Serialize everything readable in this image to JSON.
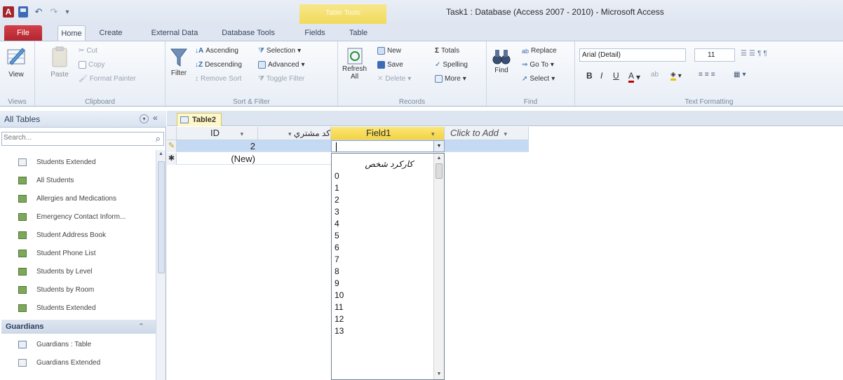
{
  "titlebar": {
    "app_letter": "A",
    "window_title": "Task1 : Database (Access 2007 - 2010) - Microsoft Access",
    "context_tab_group": "Table Tools"
  },
  "tabs": {
    "file": "File",
    "home": "Home",
    "create": "Create",
    "external": "External Data",
    "dbtools": "Database Tools",
    "fields": "Fields",
    "table": "Table"
  },
  "ribbon": {
    "views": {
      "view": "View",
      "label": "Views"
    },
    "clipboard": {
      "paste": "Paste",
      "cut": "Cut",
      "copy": "Copy",
      "format_painter": "Format Painter",
      "label": "Clipboard"
    },
    "sort_filter": {
      "filter": "Filter",
      "ascending": "Ascending",
      "descending": "Descending",
      "remove_sort": "Remove Sort",
      "selection": "Selection",
      "advanced": "Advanced",
      "toggle_filter": "Toggle Filter",
      "label": "Sort & Filter"
    },
    "records": {
      "refresh": "Refresh",
      "refresh_all": "All",
      "new": "New",
      "save": "Save",
      "delete": "Delete",
      "totals": "Totals",
      "spelling": "Spelling",
      "more": "More",
      "label": "Records"
    },
    "find": {
      "find": "Find",
      "replace": "Replace",
      "goto": "Go To",
      "select": "Select",
      "label": "Find"
    },
    "text_formatting": {
      "font": "Arial (Detail)",
      "size": "11",
      "label": "Text Formatting"
    }
  },
  "nav": {
    "title": "All Tables",
    "search_placeholder": "Search...",
    "items": [
      {
        "label": "Students Extended",
        "kind": "form"
      },
      {
        "label": "All Students",
        "kind": "query"
      },
      {
        "label": "Allergies and Medications",
        "kind": "query"
      },
      {
        "label": "Emergency Contact Inform...",
        "kind": "query"
      },
      {
        "label": "Student Address Book",
        "kind": "query"
      },
      {
        "label": "Student Phone List",
        "kind": "query"
      },
      {
        "label": "Students by Level",
        "kind": "query"
      },
      {
        "label": "Students by Room",
        "kind": "query"
      },
      {
        "label": "Students Extended",
        "kind": "query"
      }
    ],
    "group": "Guardians",
    "group_items": [
      {
        "label": "Guardians : Table",
        "kind": "table"
      },
      {
        "label": "Guardians Extended",
        "kind": "form"
      }
    ]
  },
  "document": {
    "tab": "Table2",
    "headers": {
      "id": "ID",
      "code": "كد مشتري",
      "field1": "Field1",
      "click_to_add": "Click to Add"
    },
    "rows": {
      "current_id": "2",
      "new_label": "(New)"
    },
    "dropdown_items": [
      "كاركرد شخص",
      "0",
      "1",
      "2",
      "3",
      "4",
      "5",
      "6",
      "7",
      "8",
      "9",
      "10",
      "11",
      "12",
      "13"
    ]
  },
  "icons": {
    "view": "datasheet-view-icon",
    "paste": "clipboard-icon",
    "filter": "funnel-icon",
    "refresh": "refresh-icon",
    "find": "binoculars-icon",
    "nav_search": "search-icon"
  },
  "colors": {
    "file_tab": "#b12631",
    "context_tab": "#f1da5a",
    "selected_row": "#c4d9f2",
    "active_header": "#f3d43e"
  }
}
